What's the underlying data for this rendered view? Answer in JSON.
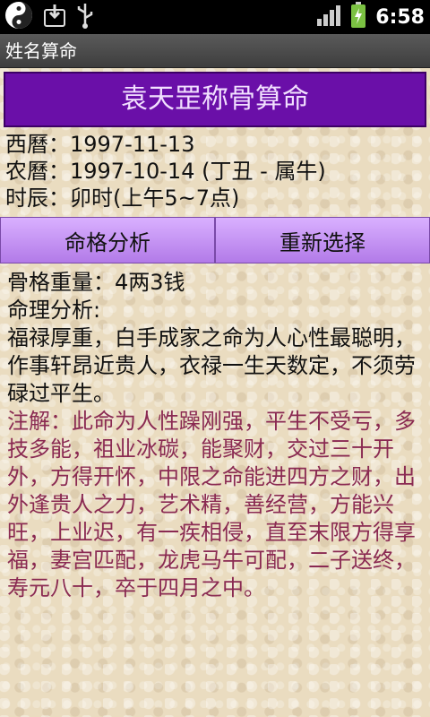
{
  "status_bar": {
    "time": "6:58",
    "icons": [
      "yin-yang-icon",
      "download-icon",
      "usb-icon",
      "signal-icon",
      "battery-charging-icon"
    ]
  },
  "app": {
    "title": "姓名算命"
  },
  "banner": {
    "title": "袁天罡称骨算命"
  },
  "dates": {
    "gregorian": "西曆：1997-11-13",
    "lunar": "农曆：1997-10-14  (丁丑 - 属牛)",
    "hour": "时辰：卯时(上午5~7点)"
  },
  "buttons": {
    "analyze": "命格分析",
    "reselect": "重新选择"
  },
  "result": {
    "bone_weight": "骨格重量：4两3钱",
    "analysis_label": "命理分析:",
    "analysis": "福禄厚重，白手成家之命为人心性最聪明，作事轩昂近贵人，衣禄一生天数定，不须劳碌过平生。",
    "note": "注解：此命为人性躁刚强，平生不受亏，多技多能，祖业冰碳，能聚财，交过三十开外，方得开怀，中限之命能进四方之财，出外逢贵人之力，艺术精，善经营，方能兴旺，上业迟，有一疾相侵，直至末限方得享福，妻宫匹配，龙虎马牛可配，二子送终，寿元八十，卒于四月之中。"
  },
  "colors": {
    "banner_bg": "#6a0fa8",
    "button_bg": "#c99af5",
    "note_text": "#8a2a52"
  }
}
